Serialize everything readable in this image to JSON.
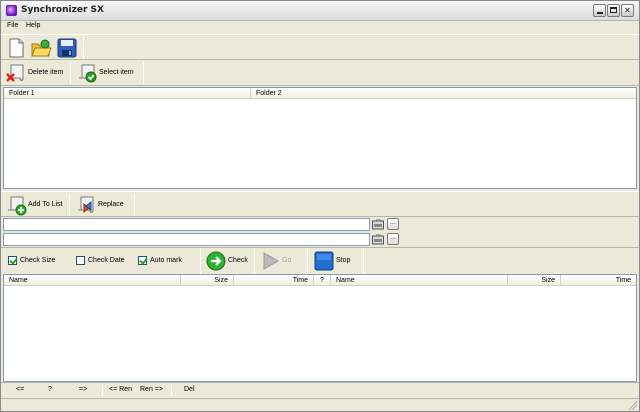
{
  "window": {
    "title": "Synchronizer SX"
  },
  "menu": {
    "file": "File",
    "help": "Help"
  },
  "toolbar": {
    "delete_item": "Delete item",
    "select_item": "Select item"
  },
  "folder_list": {
    "columns": [
      "Folder 1",
      "Folder 2"
    ]
  },
  "list_toolbar": {
    "add_to_list": "Add To List",
    "replace": "Replace"
  },
  "paths": {
    "path1_value": "",
    "path2_value": "",
    "browse_label": "..."
  },
  "options": {
    "check_size": {
      "label": "Check Size",
      "checked": true
    },
    "check_date": {
      "label": "Check Date",
      "checked": false
    },
    "auto_mark": {
      "label": "Auto mark",
      "checked": true
    },
    "check_button": "Check",
    "go_button": "Go",
    "stop_button": "Stop"
  },
  "compare_list": {
    "columns": [
      "Name",
      "Size",
      "Time",
      "?",
      "Name",
      "Size",
      "Time"
    ]
  },
  "commands": {
    "left": "<=",
    "question": "?",
    "right": "=>",
    "ren_left": "<= Ren",
    "ren_right": "Ren =>",
    "del": "Del"
  },
  "colors": {
    "accent_green": "#21a121",
    "stop_blue": "#1f6fd1",
    "list_border": "#7f9db9"
  }
}
